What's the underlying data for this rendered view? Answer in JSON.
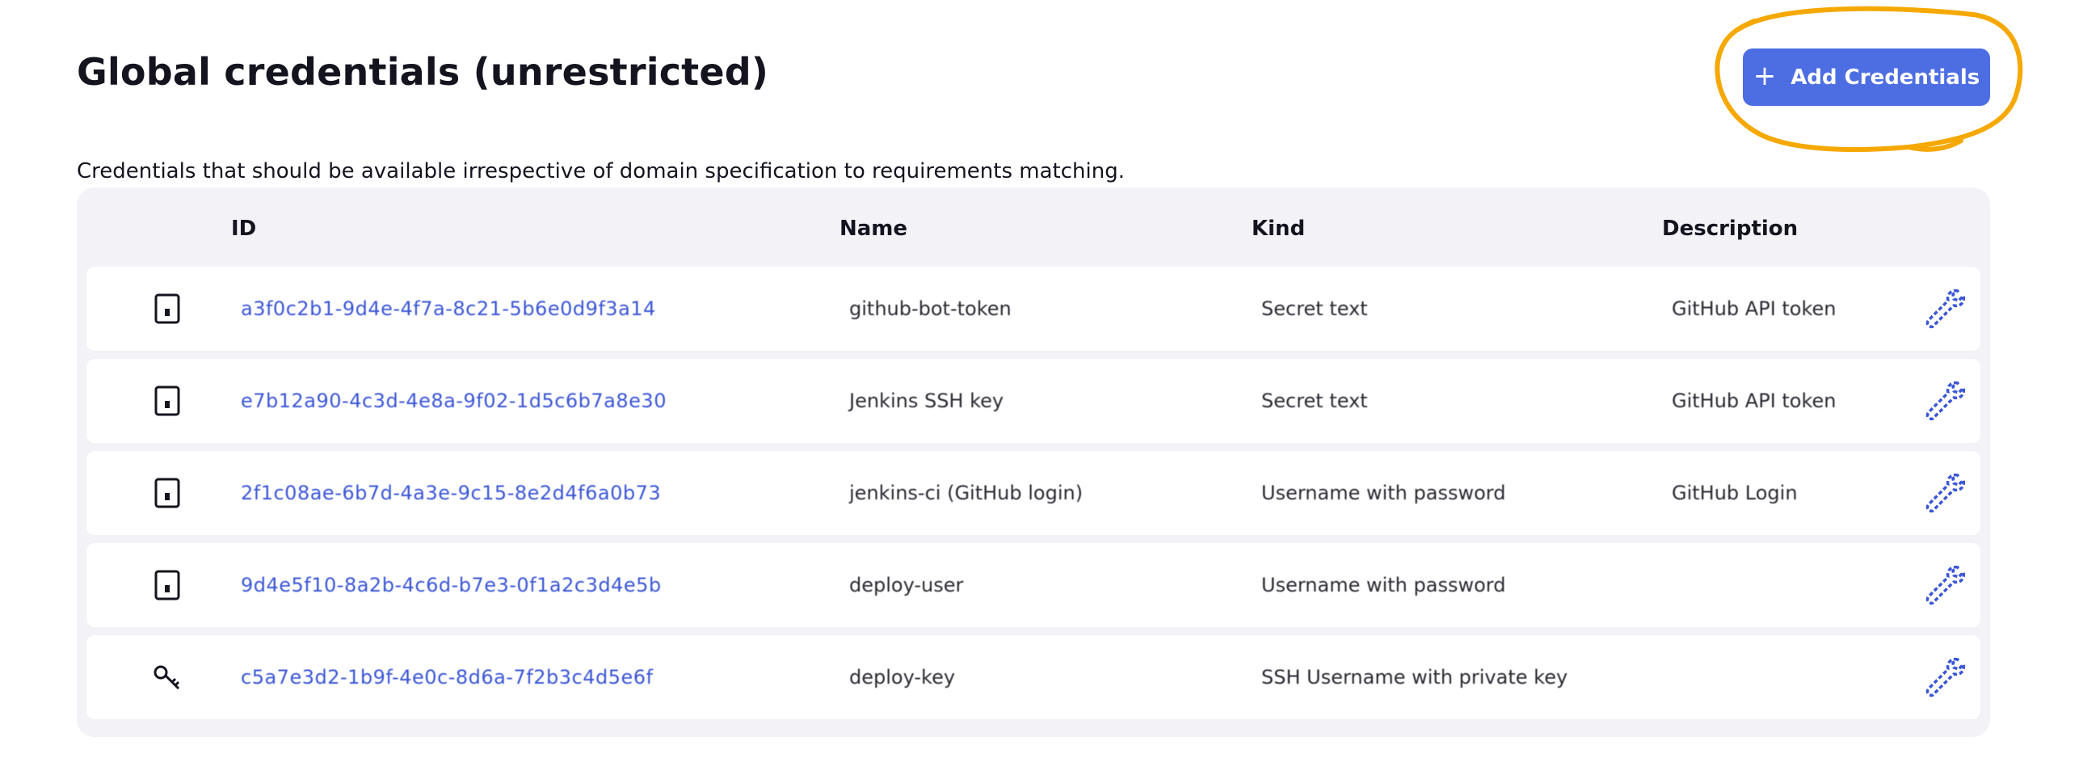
{
  "header": {
    "title": "Global credentials (unrestricted)",
    "description": "Credentials that should be available irrespective of domain specification to requirements matching.",
    "add_button": {
      "icon": "plus-icon",
      "label": "Add Credentials"
    }
  },
  "table": {
    "columns": [
      "ID",
      "Name",
      "Kind",
      "Description"
    ],
    "rows": [
      {
        "icon": "credential-icon",
        "id": "a3f0c2b1-9d4e-4f7a-8c21-5b6e0d9f3a14",
        "name": "github-bot-token",
        "kind": "Secret text",
        "description": "GitHub API token",
        "action_icon": "wrench-icon"
      },
      {
        "icon": "credential-icon",
        "id": "e7b12a90-4c3d-4e8a-9f02-1d5c6b7a8e30",
        "name": "Jenkins SSH key",
        "kind": "Secret text",
        "description": "GitHub API token",
        "action_icon": "wrench-icon"
      },
      {
        "icon": "credential-icon",
        "id": "2f1c08ae-6b7d-4a3e-9c15-8e2d4f6a0b73",
        "name": "jenkins-ci (GitHub login)",
        "kind": "Username with password",
        "description": "GitHub Login",
        "action_icon": "wrench-icon"
      },
      {
        "icon": "credential-icon",
        "id": "9d4e5f10-8a2b-4c6d-b7e3-0f1a2c3d4e5b",
        "name": "deploy-user",
        "kind": "Username with password",
        "description": "",
        "action_icon": "wrench-icon"
      },
      {
        "icon": "key-icon",
        "id": "c5a7e3d2-1b9f-4e0c-8d6a-7f2b3c4d5e6f",
        "name": "deploy-key",
        "kind": "SSH Username with private key",
        "description": "",
        "action_icon": "wrench-icon"
      }
    ]
  },
  "colors": {
    "accent": "#4d6ee2",
    "link": "#3b56d6",
    "highlight_circle": "#f5a800",
    "table_background": "#f2f2f7"
  }
}
